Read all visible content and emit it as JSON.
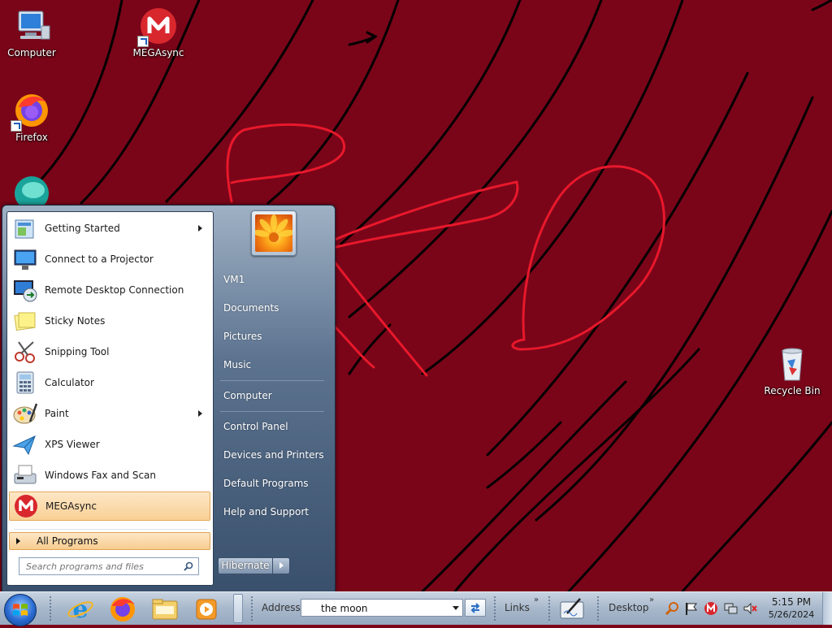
{
  "desktop": {
    "background_color": "#7a0519",
    "icons": [
      {
        "label": "Computer"
      },
      {
        "label": "MEGAsync"
      },
      {
        "label": "Firefox"
      },
      {
        "label": "Recycle Bin"
      }
    ]
  },
  "start_menu": {
    "programs": [
      {
        "label": "Getting Started",
        "submenu": true
      },
      {
        "label": "Connect to a Projector"
      },
      {
        "label": "Remote Desktop Connection"
      },
      {
        "label": "Sticky Notes"
      },
      {
        "label": "Snipping Tool"
      },
      {
        "label": "Calculator"
      },
      {
        "label": "Paint",
        "submenu": true
      },
      {
        "label": "XPS Viewer"
      },
      {
        "label": "Windows Fax and Scan"
      },
      {
        "label": "MEGAsync",
        "highlighted": true
      }
    ],
    "all_programs": "All Programs",
    "search_placeholder": "Search programs and files",
    "right_links": [
      "VM1",
      "Documents",
      "Pictures",
      "Music",
      "Computer",
      "Control Panel",
      "Devices and Printers",
      "Default Programs",
      "Help and Support"
    ],
    "shutdown_label": "Hibernate"
  },
  "taskbar": {
    "address_label": "Address",
    "address_value": "the moon",
    "links_label": "Links",
    "desktop_label": "Desktop",
    "chevron": "»",
    "clock_time": "5:15 PM",
    "clock_date": "5/26/2024"
  }
}
